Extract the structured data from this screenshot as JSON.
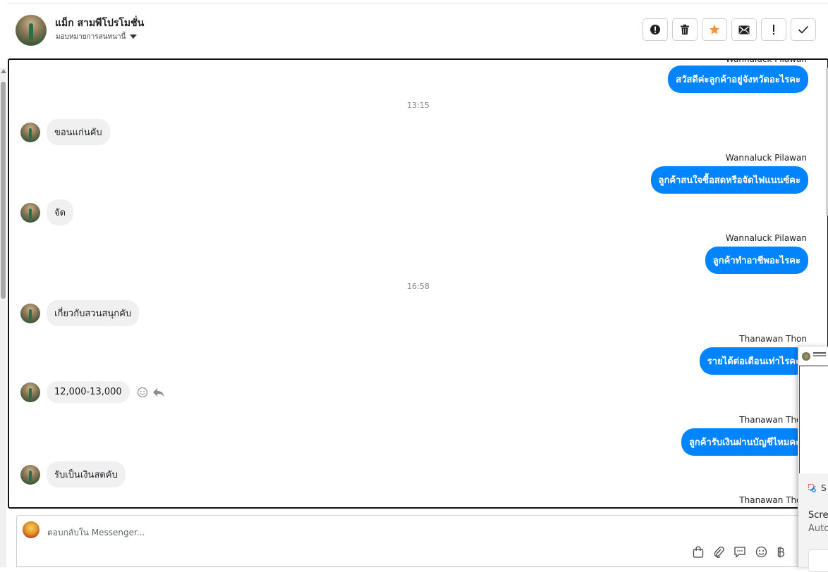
{
  "header": {
    "name": "แม็ก สามพีโปรโมชั่น",
    "assign_label": "มอบหมายการสนทนานี้",
    "actions": [
      {
        "name": "spam-button",
        "icon": "exclamation-circle-icon"
      },
      {
        "name": "delete-button",
        "icon": "trash-icon"
      },
      {
        "name": "star-button",
        "icon": "star-icon"
      },
      {
        "name": "mark-unread-button",
        "icon": "envelope-icon"
      },
      {
        "name": "follow-up-button",
        "icon": "exclamation-icon"
      },
      {
        "name": "mark-done-button",
        "icon": "check-icon"
      }
    ],
    "star_color": "#f7923a"
  },
  "conversation": {
    "top_partial_sender": "Wannaluck Pilawan",
    "out1": "สวัสดีค่ะลูกค้าอยู่จังหวัดอะไรคะ",
    "time1": "13:15",
    "in1": "ขอนแก่นคับ",
    "sender2": "Wannaluck Pilawan",
    "out2": "ลูกค้าสนใจซื้อสดหรือจัดไฟแนนซ์คะ",
    "in2": "จัด",
    "sender3": "Wannaluck Pilawan",
    "out3": "ลูกค้าทำอาชีพอะไรคะ",
    "time2": "16:58",
    "in3": "เกี่ยวกับสวนสนุกคับ",
    "sender4": "Thanawan Thon",
    "out4": "รายได้ต่อเดือนเท่าไรคะ",
    "in4": "12,000-13,000",
    "sender5": "Thanawan Thon",
    "out5": "ลูกค้ารับเงินผ่านบัญชีไหมคะ",
    "in5": "รับเป็นเงินสดคับ",
    "sender6": "Thanawan Thon",
    "bubble_color": "#0084ff"
  },
  "composer": {
    "placeholder": "ตอบกลับใน Messenger...",
    "tools": [
      "shopping-bag-icon",
      "paperclip-icon",
      "saved-reply-icon",
      "emoji-icon",
      "baht-icon"
    ]
  },
  "overlay": {
    "snip_label": "S",
    "line1": "Scre",
    "line2": "Auto"
  }
}
